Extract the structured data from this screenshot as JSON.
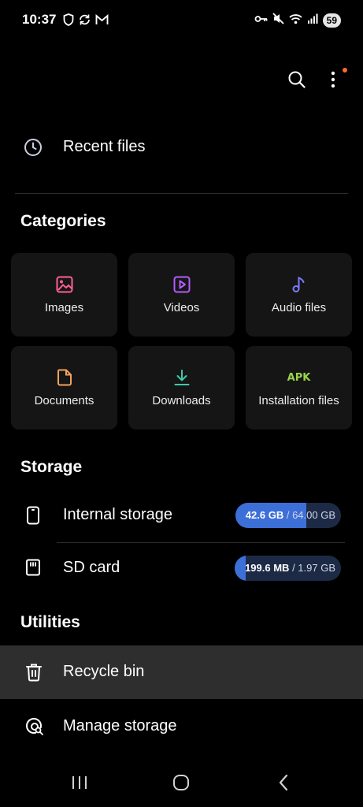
{
  "status_bar": {
    "time": "10:37",
    "battery": "59",
    "left_icons": [
      "shield-icon",
      "sync-icon",
      "gmail-icon"
    ],
    "right_icons": [
      "key-icon",
      "mute-icon",
      "wifi-icon",
      "signal-icon"
    ]
  },
  "top_actions": {
    "search_icon": "search-icon",
    "more_icon": "more-vert-icon",
    "notification_dot_color": "#ff6a2b"
  },
  "recent": {
    "label": "Recent files",
    "icon": "clock-icon"
  },
  "categories": {
    "title": "Categories",
    "items": [
      {
        "label": "Images",
        "icon": "image-icon",
        "color": "#ff5f96"
      },
      {
        "label": "Videos",
        "icon": "video-icon",
        "color": "#b45cff"
      },
      {
        "label": "Audio files",
        "icon": "music-note-icon",
        "color": "#7c7cff"
      },
      {
        "label": "Documents",
        "icon": "document-icon",
        "color": "#f2a25c"
      },
      {
        "label": "Downloads",
        "icon": "download-icon",
        "color": "#3fc9a8"
      },
      {
        "label": "Installation files",
        "icon": "apk-icon",
        "icon_text": "APK",
        "color": "#9ad34a"
      }
    ]
  },
  "storage": {
    "title": "Storage",
    "items": [
      {
        "label": "Internal storage",
        "icon": "phone-icon",
        "used": "42.6 GB",
        "separator": " / ",
        "total": "64.00 GB",
        "fill_fraction": 0.67
      },
      {
        "label": "SD card",
        "icon": "sd-card-icon",
        "used": "199.6 MB",
        "separator": " / ",
        "total": "1.97 GB",
        "fill_fraction": 0.1
      }
    ]
  },
  "utilities": {
    "title": "Utilities",
    "items": [
      {
        "label": "Recycle bin",
        "icon": "trash-icon"
      },
      {
        "label": "Manage storage",
        "icon": "manage-storage-icon"
      }
    ]
  },
  "nav_bar": {
    "items": [
      "recents-icon",
      "home-icon",
      "back-icon"
    ]
  },
  "colors": {
    "background": "#000000",
    "tile_background": "#151515",
    "highlight_row": "#2e2e2e",
    "storage_fill": "#3d6fd8",
    "storage_track": "#1d2a46"
  }
}
